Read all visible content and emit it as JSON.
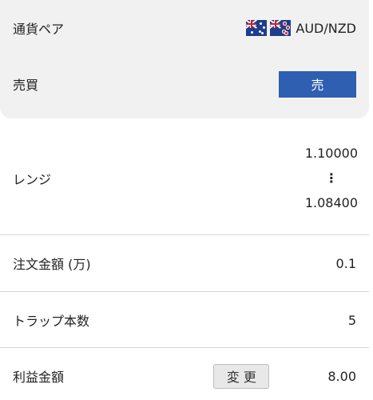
{
  "summary": {
    "pair_label": "通貨ペア",
    "pair_value": "AUD/NZD",
    "pair_flags": [
      "au-flag-icon",
      "nz-flag-icon"
    ],
    "side_label": "売買",
    "side_value": "売",
    "side_color": "#2e5fb0"
  },
  "details": {
    "range_label": "レンジ",
    "range_high": "1.10000",
    "range_separator": "⋮",
    "range_low": "1.08400",
    "amount_label": "注文金額 (万)",
    "amount_value": "0.1",
    "trap_count_label": "トラップ本数",
    "trap_count_value": "5",
    "profit_label": "利益金額",
    "change_button": "変 更",
    "profit_value": "8.00"
  }
}
